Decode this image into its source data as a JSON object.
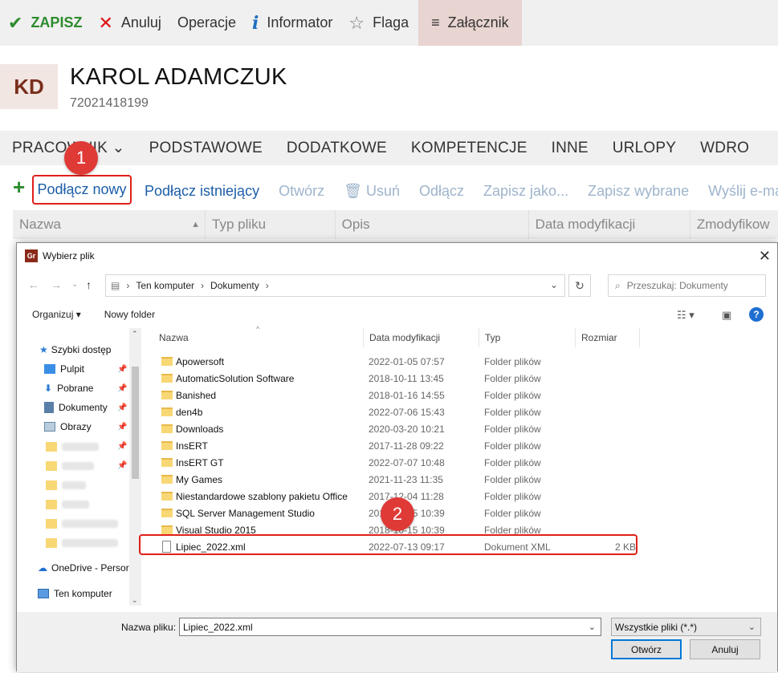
{
  "toolbar": {
    "save": "ZAPISZ",
    "cancel": "Anuluj",
    "operations": "Operacje",
    "info": "Informator",
    "flag": "Flaga",
    "attachment": "Załącznik"
  },
  "person": {
    "initials": "KD",
    "name": "KAROL ADAMCZUK",
    "id": "72021418199"
  },
  "tabs": [
    "PRACOWNIK",
    "PODSTAWOWE",
    "DODATKOWE",
    "KOMPETENCJE",
    "INNE",
    "URLOPY",
    "WDRO"
  ],
  "actions": {
    "attach_new": "Podłącz nowy",
    "attach_existing": "Podłącz istniejący",
    "open": "Otwórz",
    "delete": "Usuń",
    "detach": "Odłącz",
    "save_as": "Zapisz jako...",
    "save_selected": "Zapisz wybrane",
    "send_email": "Wyślij e-maile"
  },
  "grid_headers": [
    "Nazwa",
    "Typ pliku",
    "Opis",
    "Data modyfikacji",
    "Zmodyfikow"
  ],
  "badges": [
    "1",
    "2"
  ],
  "dialog": {
    "title": "Wybierz plik",
    "app_icon": "Gr",
    "path": [
      "Ten komputer",
      "Dokumenty"
    ],
    "search_placeholder": "Przeszukaj: Dokumenty",
    "organize": "Organizuj ▾",
    "new_folder": "Nowy folder",
    "columns": [
      "Nazwa",
      "Data modyfikacji",
      "Typ",
      "Rozmiar"
    ],
    "nav": {
      "quick_access": "Szybki dostęp",
      "items": [
        "Pulpit",
        "Pobrane",
        "Dokumenty",
        "Obrazy"
      ],
      "onedrive": "OneDrive - Persor",
      "this_pc": "Ten komputer"
    },
    "files": [
      {
        "name": "Apowersoft",
        "date": "2022-01-05 07:57",
        "type": "Folder plików",
        "size": ""
      },
      {
        "name": "AutomaticSolution Software",
        "date": "2018-10-11 13:45",
        "type": "Folder plików",
        "size": ""
      },
      {
        "name": "Banished",
        "date": "2018-01-16 14:55",
        "type": "Folder plików",
        "size": ""
      },
      {
        "name": "den4b",
        "date": "2022-07-06 15:43",
        "type": "Folder plików",
        "size": ""
      },
      {
        "name": "Downloads",
        "date": "2020-03-20 10:21",
        "type": "Folder plików",
        "size": ""
      },
      {
        "name": "InsERT",
        "date": "2017-11-28 09:22",
        "type": "Folder plików",
        "size": ""
      },
      {
        "name": "InsERT GT",
        "date": "2022-07-07 10:48",
        "type": "Folder plików",
        "size": ""
      },
      {
        "name": "My Games",
        "date": "2021-11-23 11:35",
        "type": "Folder plików",
        "size": ""
      },
      {
        "name": "Niestandardowe szablony pakietu Office",
        "date": "2017-12-04 11:28",
        "type": "Folder plików",
        "size": ""
      },
      {
        "name": "SQL Server Management Studio",
        "date": "2018-10-15 10:39",
        "type": "Folder plików",
        "size": ""
      },
      {
        "name": "Visual Studio 2015",
        "date": "2018-10-15 10:39",
        "type": "Folder plików",
        "size": ""
      },
      {
        "name": "Lipiec_2022.xml",
        "date": "2022-07-13 09:17",
        "type": "Dokument XML",
        "size": "2 KB"
      }
    ],
    "filename_label": "Nazwa pliku:",
    "filename_value": "Lipiec_2022.xml",
    "filter": "Wszystkie pliki (*.*)",
    "open_button": "Otwórz",
    "cancel_button": "Anuluj"
  },
  "colors": {
    "accent_red": "#e03a36",
    "link_blue": "#1c5ea8",
    "save_green": "#2e8b2e",
    "selection": "#cce8ff"
  }
}
